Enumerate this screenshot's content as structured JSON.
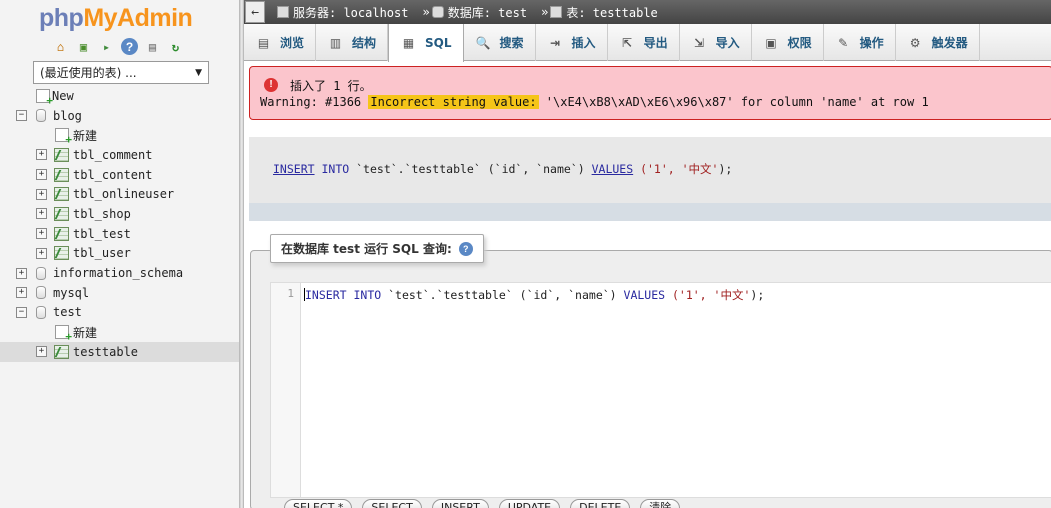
{
  "nav": {
    "logo_php": "php",
    "logo_myadmin": "MyAdmin",
    "icons": [
      "home-icon",
      "exit-icon",
      "sql-query-icon",
      "help-icon",
      "docs-icon",
      "reload-icon"
    ],
    "recent_tables": "(最近使用的表) ...",
    "tree": [
      {
        "label": "New",
        "type": "new",
        "level": 0
      },
      {
        "label": "blog",
        "type": "db",
        "level": 0,
        "expanded": true
      },
      {
        "label": "新建",
        "type": "new",
        "level": 1
      },
      {
        "label": "tbl_comment",
        "type": "table",
        "level": 1
      },
      {
        "label": "tbl_content",
        "type": "table",
        "level": 1
      },
      {
        "label": "tbl_onlineuser",
        "type": "table",
        "level": 1
      },
      {
        "label": "tbl_shop",
        "type": "table",
        "level": 1
      },
      {
        "label": "tbl_test",
        "type": "table",
        "level": 1
      },
      {
        "label": "tbl_user",
        "type": "table",
        "level": 1
      },
      {
        "label": "information_schema",
        "type": "db",
        "level": 0,
        "expanded": false
      },
      {
        "label": "mysql",
        "type": "db",
        "level": 0,
        "expanded": false
      },
      {
        "label": "test",
        "type": "db",
        "level": 0,
        "expanded": true
      },
      {
        "label": "新建",
        "type": "new",
        "level": 1
      },
      {
        "label": "testtable",
        "type": "table",
        "level": 1,
        "selected": true
      }
    ]
  },
  "breadcrumb": {
    "server": "服务器: localhost",
    "database": "数据库: test",
    "table": "表: testtable"
  },
  "tabs": [
    {
      "label": "浏览",
      "icon": "browse-icon"
    },
    {
      "label": "结构",
      "icon": "structure-icon"
    },
    {
      "label": "SQL",
      "icon": "sql-icon",
      "active": true
    },
    {
      "label": "搜索",
      "icon": "search-icon"
    },
    {
      "label": "插入",
      "icon": "insert-icon"
    },
    {
      "label": "导出",
      "icon": "export-icon"
    },
    {
      "label": "导入",
      "icon": "import-icon"
    },
    {
      "label": "权限",
      "icon": "privileges-icon"
    },
    {
      "label": "操作",
      "icon": "operations-icon"
    },
    {
      "label": "触发器",
      "icon": "triggers-icon"
    }
  ],
  "message": {
    "title": "插入了 1 行。",
    "warning_prefix": "Warning: #1366 ",
    "warning_highlight": "Incorrect string value:",
    "warning_suffix": " '\\xE4\\xB8\\xAD\\xE6\\x96\\x87' for column 'name' at row 1"
  },
  "executed_sql": {
    "insert": "INSERT",
    "into": "INTO",
    "db": "`test`",
    "dot": ".",
    "table": "`testtable`",
    "cols": "(`id`, `name`)",
    "values": "VALUES",
    "vals_open": "('1', ",
    "val2": "'中文'",
    "vals_close": ");"
  },
  "query_form": {
    "legend": "在数据库 test 运行 SQL 查询:",
    "line_number": "1",
    "code": {
      "insert": "INSERT",
      "into": "INTO",
      "rest1": " `test`.`testtable` (`id`, `name`) ",
      "values": "VALUES",
      "rest2": " ('1', ",
      "val2": "'中文'",
      "rest3": ");"
    },
    "buttons": [
      "SELECT *",
      "SELECT",
      "INSERT",
      "UPDATE",
      "DELETE",
      "清除"
    ]
  }
}
